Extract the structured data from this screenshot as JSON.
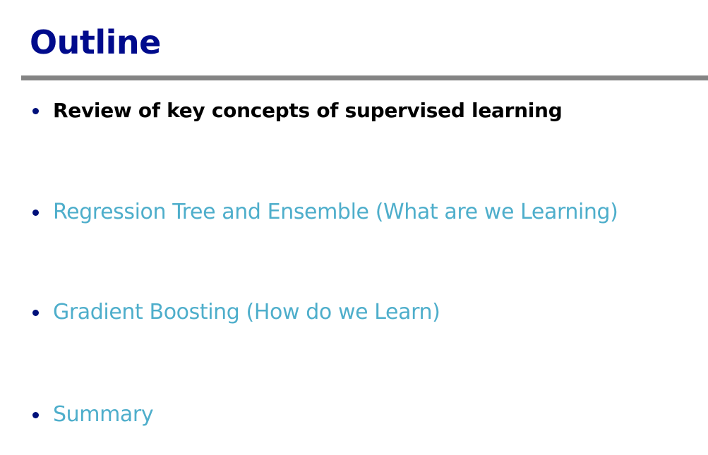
{
  "slide": {
    "title": "Outline",
    "colors": {
      "title": "#000b8c",
      "rule": "#848484",
      "bullet": "#00107a",
      "active_text": "#000000",
      "inactive_text": "#4eaecb"
    },
    "items": [
      {
        "label": "Review of key concepts of supervised learning",
        "state": "active"
      },
      {
        "label": "Regression Tree and Ensemble (What are we Learning)",
        "state": "inactive"
      },
      {
        "label": "Gradient Boosting (How do we Learn)",
        "state": "inactive"
      },
      {
        "label": "Summary",
        "state": "inactive"
      }
    ]
  }
}
